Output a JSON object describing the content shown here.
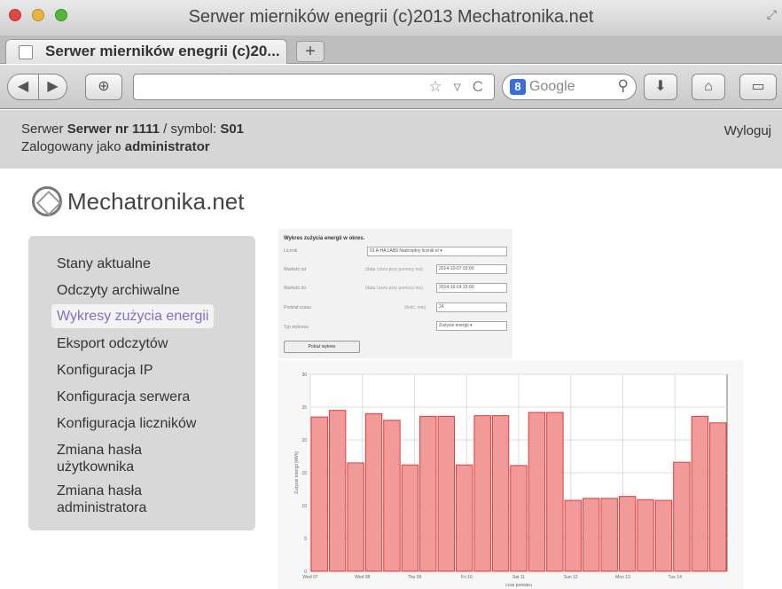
{
  "browser": {
    "window_title": "Serwer mierników enegrii (c)2013 Mechatronika.net",
    "tab_title": "Serwer mierników enegrii (c)20...",
    "new_tab": "+",
    "search_placeholder": "Google"
  },
  "header": {
    "server_prefix": "Serwer ",
    "server_name": "Serwer nr 1111",
    "symbol_prefix": " / symbol: ",
    "symbol": "S01",
    "logged_prefix": "Zalogowany jako ",
    "user": "administrator",
    "logout": "Wyloguj"
  },
  "logo": {
    "text": "Mechatronika.net"
  },
  "sidebar": {
    "items": [
      {
        "label": "Stany aktualne"
      },
      {
        "label": "Odczyty archiwalne"
      },
      {
        "label": "Wykresy zużycia energii"
      },
      {
        "label": "Eksport odczytów"
      },
      {
        "label": "Konfiguracja IP"
      },
      {
        "label": "Konfiguracja serwera"
      },
      {
        "label": "Konfiguracja liczników"
      },
      {
        "label": "Zmiana hasła użytkownika"
      },
      {
        "label": "Zmiana hasła administratora"
      }
    ]
  },
  "form": {
    "title": "Wykres zużycia energii w okres.",
    "fields": [
      {
        "label": "Licznik",
        "hint": "",
        "value": "01 A-HA LAB9 Nadrzędny licznik el ▾"
      },
      {
        "label": "Wartość od",
        "hint": "(data i pora przy pomocy ms)",
        "value": "2014-10-07 03:00"
      },
      {
        "label": "Wartość do",
        "hint": "(data i pora przy pomocy ms)",
        "value": "2014-10-14 23:00"
      },
      {
        "label": "Podział czasu",
        "hint": "(ilość, min)",
        "value": "24"
      },
      {
        "label": "Typ wykresu",
        "hint": "",
        "value": "Zużycie energii ▾"
      }
    ],
    "submit": "Pokaż wykres"
  },
  "chart_data": {
    "type": "bar",
    "ylabel": "Zużycie energii [kWh]",
    "xlabel": "czas pomiaru",
    "ylim": [
      0,
      30
    ],
    "yticks": [
      0,
      5,
      10,
      15,
      20,
      25,
      30
    ],
    "x_tick_labels": [
      "Wed 07",
      "Wed 08",
      "Thu 09",
      "Fri 10",
      "Sat 11",
      "Sun 12",
      "Mon 13",
      "Tue 14"
    ],
    "values": [
      23.5,
      24.5,
      16.5,
      24.0,
      23.0,
      16.2,
      23.6,
      23.6,
      16.2,
      23.7,
      23.7,
      16.1,
      24.2,
      24.2,
      10.8,
      11.1,
      11.1,
      11.4,
      10.9,
      10.8,
      16.6,
      23.6,
      22.6
    ],
    "bar_color": "#f29a9a",
    "bar_edge": "#e03a3a"
  }
}
